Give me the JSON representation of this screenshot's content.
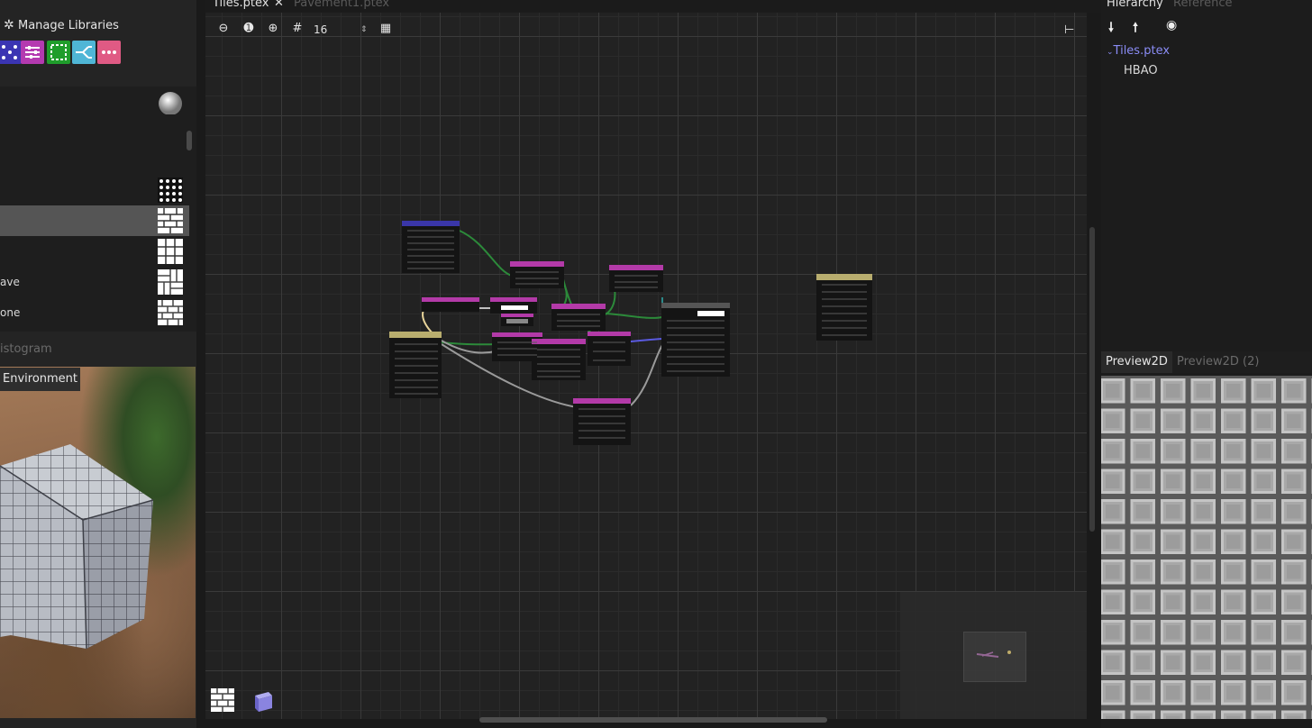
{
  "tabs": [
    {
      "label": "Tiles.ptex",
      "active": true
    },
    {
      "label": "Pavement1.ptex",
      "active": false
    }
  ],
  "toolbar": {
    "zoom_value": "16"
  },
  "left": {
    "manage_libraries": "Manage Libraries",
    "library_items": [
      {
        "label": "",
        "selected": false
      },
      {
        "label": "",
        "selected": false
      },
      {
        "label": "",
        "selected": true
      },
      {
        "label": "",
        "selected": false
      },
      {
        "label": "ave",
        "selected": false
      },
      {
        "label": "one",
        "selected": false
      }
    ],
    "histogram_tab": "istogram",
    "environment_tab": "Environment"
  },
  "right": {
    "hierarchy_tab": "Hierarchy",
    "reference_tab": "Reference",
    "tree_root": "Tiles.ptex",
    "tree_child": "HBAO",
    "preview_tab1": "Preview2D",
    "preview_tab2": "Preview2D (2)"
  },
  "colors": {
    "node_header_purple": "#b33aa8",
    "node_header_tan": "#b8ad6e",
    "node_header_blue": "#3a36a8",
    "node_header_gray": "#555555",
    "accent_link": "#8a8cf5"
  },
  "icons": [
    "settings-gear-icon",
    "zoom-out-icon",
    "zoom-reset-icon",
    "zoom-in-icon",
    "snap-grid-icon",
    "grid-toggle-icon",
    "arrow-down-icon",
    "arrow-up-icon",
    "eye-icon",
    "hierarchy-corner-icon",
    "tile-pattern-icon",
    "cube-icon"
  ]
}
